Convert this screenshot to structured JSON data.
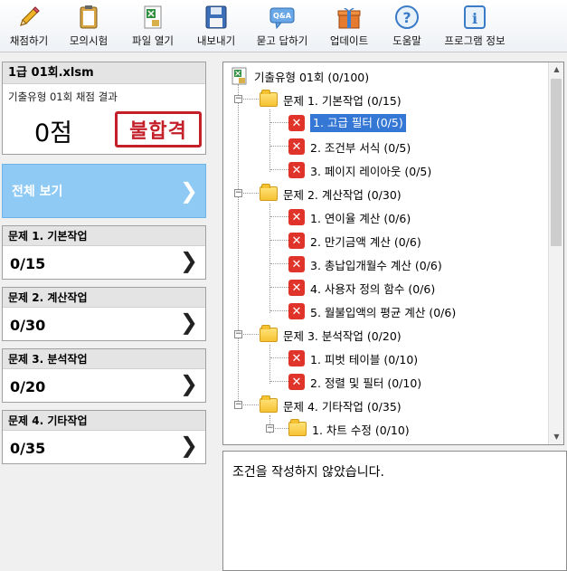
{
  "toolbar": {
    "items": [
      {
        "label": "채점하기",
        "icon": "pencil-icon"
      },
      {
        "label": "모의시험",
        "icon": "clipboard-icon"
      },
      {
        "label": "파일 열기",
        "icon": "excel-file-icon"
      },
      {
        "label": "내보내기",
        "icon": "save-disk-icon"
      },
      {
        "label": "묻고 답하기",
        "icon": "qa-bubble-icon"
      },
      {
        "label": "업데이트",
        "icon": "gift-box-icon"
      },
      {
        "label": "도움말",
        "icon": "help-icon"
      },
      {
        "label": "프로그램 정보",
        "icon": "info-icon"
      }
    ]
  },
  "file_card": {
    "filename": "1급 01회.xlsm",
    "subtitle": "기출유형 01회 채점 결과",
    "score": "0점",
    "stamp": "불합격"
  },
  "all_view": {
    "label": "전체 보기"
  },
  "question_cards": [
    {
      "title": "문제 1. 기본작업",
      "score": "0/15"
    },
    {
      "title": "문제 2. 계산작업",
      "score": "0/30"
    },
    {
      "title": "문제 3. 분석작업",
      "score": "0/20"
    },
    {
      "title": "문제 4. 기타작업",
      "score": "0/35"
    }
  ],
  "tree": {
    "root": "기출유형 01회 (0/100)",
    "groups": [
      {
        "label": "문제 1. 기본작업 (0/15)",
        "items": [
          "1. 고급 필터 (0/5)",
          "2. 조건부 서식 (0/5)",
          "3. 페이지 레이아웃 (0/5)"
        ]
      },
      {
        "label": "문제 2. 계산작업 (0/30)",
        "items": [
          "1. 연이율 계산 (0/6)",
          "2. 만기금액 계산 (0/6)",
          "3. 총납입개월수 계산 (0/6)",
          "4. 사용자 정의 함수 (0/6)",
          "5. 월불입액의 평균 계산 (0/6)"
        ]
      },
      {
        "label": "문제 3. 분석작업 (0/20)",
        "items": [
          "1. 피벗 테이블 (0/10)",
          "2. 정렬 및 필터 (0/10)"
        ]
      },
      {
        "label": "문제 4. 기타작업 (0/35)",
        "subfolders": [
          "1. 차트 수정 (0/10)"
        ]
      }
    ]
  },
  "message": "조건을 작성하지 않았습니다.",
  "colors": {
    "accent": "#8fcaf4",
    "selected": "#3477d4",
    "error": "#e0342a",
    "stamp": "#c4202a"
  }
}
